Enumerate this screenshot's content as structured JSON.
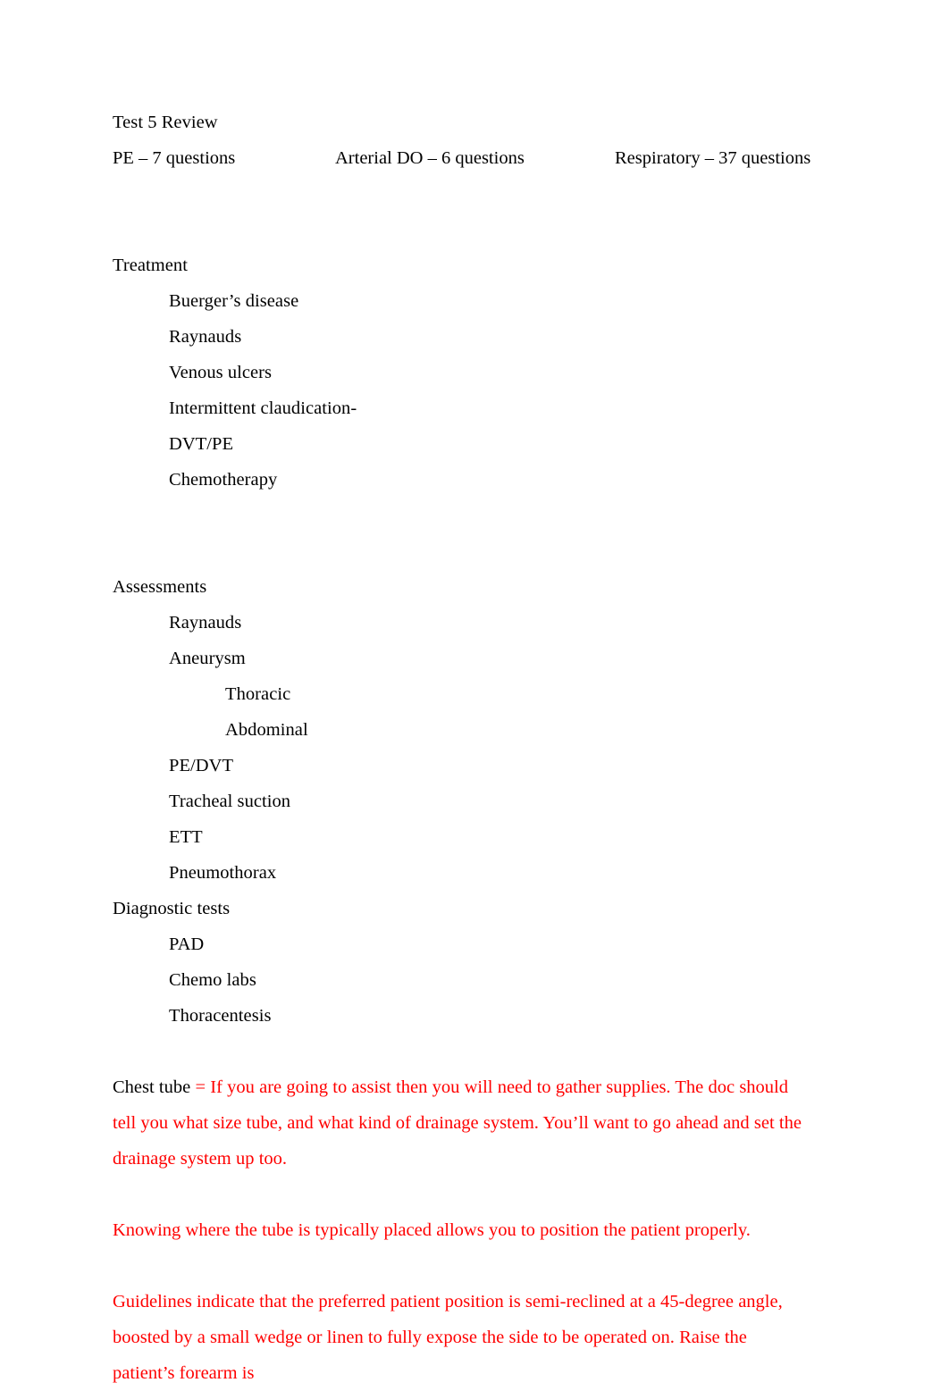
{
  "document": {
    "title": "Test 5 Review",
    "header_columns": [
      "PE – 7 questions",
      "Arterial DO – 6 questions",
      "Respiratory – 37 questions"
    ],
    "sections": [
      {
        "heading": "Treatment",
        "items": [
          {
            "text": "Buerger’s disease",
            "level": 1
          },
          {
            "text": "Raynauds",
            "level": 1
          },
          {
            "text": "Venous ulcers",
            "level": 1
          },
          {
            "text": "Intermittent claudication-",
            "level": 1
          },
          {
            "text": "DVT/PE",
            "level": 1
          },
          {
            "text": "Chemotherapy",
            "level": 1
          }
        ]
      },
      {
        "heading": "Assessments",
        "items": [
          {
            "text": "Raynauds",
            "level": 1
          },
          {
            "text": "Aneurysm",
            "level": 1
          },
          {
            "text": "Thoracic",
            "level": 2
          },
          {
            "text": "Abdominal",
            "level": 2
          },
          {
            "text": "PE/DVT",
            "level": 1
          },
          {
            "text": "Tracheal suction",
            "level": 1
          },
          {
            "text": "ETT",
            "level": 1
          },
          {
            "text": "Pneumothorax",
            "level": 1
          }
        ]
      },
      {
        "heading": "Diagnostic tests",
        "items": [
          {
            "text": "PAD",
            "level": 1
          },
          {
            "text": "Chemo labs",
            "level": 1
          },
          {
            "text": "Thoracentesis",
            "level": 1
          }
        ]
      }
    ],
    "notes": {
      "chest_tube_label": "Chest tube ",
      "chest_tube_body": "= If you are going to assist then you will need to gather supplies. The doc should tell you what size tube, and what kind of drainage system. You’ll want to go ahead and set the drainage system up too.",
      "paragraph_2": "Knowing where the tube is typically placed allows you to position the patient properly.",
      "paragraph_3": "Guidelines indicate that the preferred patient position is semi-reclined at a 45-degree angle, boosted by a small wedge or linen to fully expose the side to be operated on. Raise the patient’s forearm is"
    },
    "colors": {
      "note_text": "#ff0000",
      "body_text": "#000000",
      "page_background": "#ffffff"
    }
  }
}
